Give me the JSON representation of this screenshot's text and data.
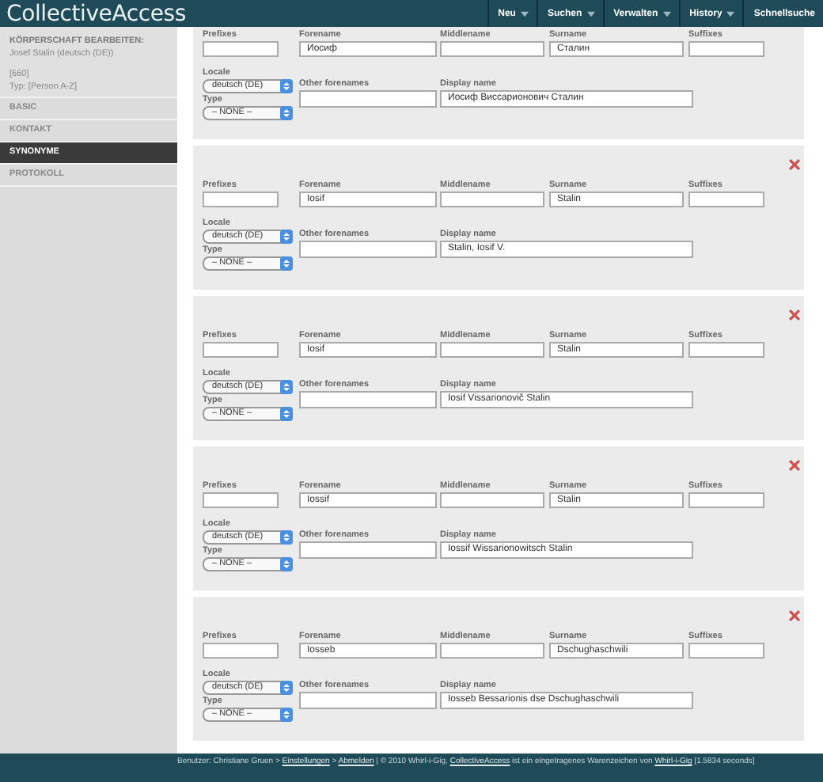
{
  "header": {
    "logo": "CollectiveAccess",
    "nav": [
      {
        "label": "Neu",
        "dropdown": true
      },
      {
        "label": "Suchen",
        "dropdown": true
      },
      {
        "label": "Verwalten",
        "dropdown": true
      },
      {
        "label": "History",
        "dropdown": true
      },
      {
        "label": "Schnellsuche",
        "dropdown": false
      }
    ]
  },
  "sidebar": {
    "heading": "KÖRPERSCHAFT BEARBEITEN:",
    "record": "Josef Stalin (deutsch (DE))",
    "id": "[660]",
    "type": "Typ: [Person A-Z]",
    "items": [
      {
        "label": "BASIC",
        "selected": false
      },
      {
        "label": "KONTAKT",
        "selected": false
      },
      {
        "label": "SYNONYME",
        "selected": true
      },
      {
        "label": "PROTOKOLL",
        "selected": false
      }
    ]
  },
  "names": [
    {
      "kind": "partial",
      "labels": {
        "prefixes": "Prefixes",
        "forename": "Forename",
        "middlename": "Middlename",
        "surname": "Surname",
        "suffixes": "Suffixes",
        "locale": "Locale",
        "type": "Type",
        "other": "Other forenames",
        "display": "Display name"
      },
      "forename": "Иосиф",
      "surname": "Сталин",
      "locale": "deutsch (DE)",
      "type": "– NONE –",
      "display": "Иосиф Виссарионович Сталин"
    },
    {
      "kind": "full",
      "labels": {
        "prefixes": "Prefixes",
        "forename": "Forename",
        "middlename": "Middlename",
        "surname": "Surname",
        "suffixes": "Suffixes",
        "locale": "Locale",
        "type": "Type",
        "other": "Other forenames",
        "display": "Display name"
      },
      "forename": "Iosif",
      "surname": "Stalin",
      "locale": "deutsch (DE)",
      "type": "– NONE –",
      "display": "Stalin, Iosif V."
    },
    {
      "kind": "full",
      "labels": {
        "prefixes": "Prefixes",
        "forename": "Forename",
        "middlename": "Middlename",
        "surname": "Surname",
        "suffixes": "Suffixes",
        "locale": "Locale",
        "type": "Type",
        "other": "Other forenames",
        "display": "Display name"
      },
      "forename": "Iosif",
      "surname": "Stalin",
      "locale": "deutsch (DE)",
      "type": "– NONE –",
      "display": "Iosif Vissarionovič Stalin"
    },
    {
      "kind": "full",
      "labels": {
        "prefixes": "Prefixes",
        "forename": "Forename",
        "middlename": "Middlename",
        "surname": "Surname",
        "suffixes": "Suffixes",
        "locale": "Locale",
        "type": "Type",
        "other": "Other forenames",
        "display": "Display name"
      },
      "forename": "Iossif",
      "surname": "Stalin",
      "locale": "deutsch (DE)",
      "type": "– NONE –",
      "display": "Iossif Wissarionowitsch Stalin"
    },
    {
      "kind": "full",
      "labels": {
        "prefixes": "Prefixes",
        "forename": "Forename",
        "middlename": "Middlename",
        "surname": "Surname",
        "suffixes": "Suffixes",
        "locale": "Locale",
        "type": "Type",
        "other": "Other forenames",
        "display": "Display name"
      },
      "forename": "Iosseb",
      "surname": "Dschughaschwili",
      "locale": "deutsch (DE)",
      "type": "– NONE –",
      "display": "Iosseb Bessarionis dse Dschughaschwili"
    }
  ],
  "footer": [
    {
      "text": "Benutzer: Christiane Gruen >",
      "link": false
    },
    {
      "text": "Einstellungen",
      "link": true
    },
    {
      "text": ">",
      "link": false
    },
    {
      "text": "Abmelden",
      "link": true
    },
    {
      "text": "| © 2010 Whirl-i-Gig,",
      "link": false
    },
    {
      "text": "CollectiveAccess",
      "link": true
    },
    {
      "text": "ist ein eingetragenes Warenzeichen von",
      "link": false
    },
    {
      "text": "Whirl-i-Gig",
      "link": true
    },
    {
      "text": "[1.5834 seconds]",
      "link": false
    }
  ]
}
